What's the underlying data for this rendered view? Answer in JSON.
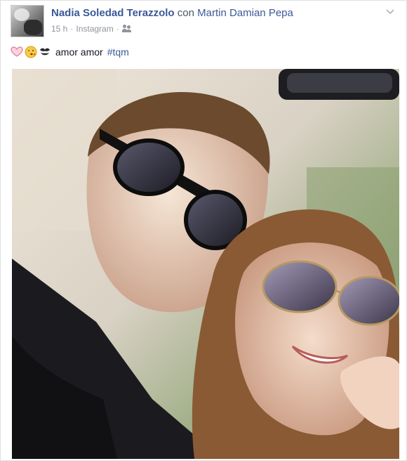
{
  "post": {
    "author": "Nadia Soledad Terazzolo",
    "with_word": "con",
    "tagged": "Martin Damian Pepa",
    "time": "15 h",
    "separator": "·",
    "source": "Instagram",
    "message_text": "amor amor",
    "hashtag": "#tqm",
    "emojis": [
      "heart-icon",
      "kiss-face-icon",
      "kiss-mark-icon"
    ],
    "menu_icon": "chevron-down-icon",
    "audience_icon": "friends-icon",
    "colors": {
      "link": "#3b5998",
      "text": "#141823",
      "meta": "#90949c",
      "heart": "#f7b6c3"
    }
  }
}
